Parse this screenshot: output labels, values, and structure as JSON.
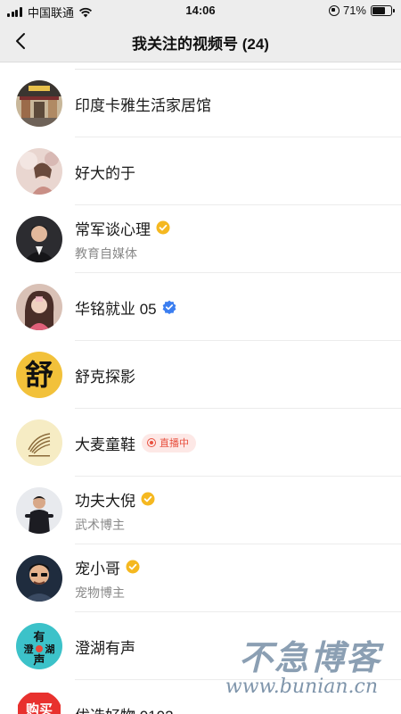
{
  "status_bar": {
    "carrier": "中国联通",
    "time": "14:06",
    "battery": "71%",
    "battery_level": 0.71
  },
  "nav": {
    "title": "我关注的视频号 (24)",
    "back_icon": "chevron-left-icon"
  },
  "items": [
    {
      "name": "印度卡雅生活家居馆",
      "sub": ""
    },
    {
      "name": "好大的于",
      "sub": ""
    },
    {
      "name": "常军谈心理",
      "sub": "教育自媒体",
      "badge": "yellow"
    },
    {
      "name": "华铭就业 05",
      "sub": "",
      "badge": "blue"
    },
    {
      "name": "舒克探影",
      "sub": "",
      "avatar_text": "舒"
    },
    {
      "name": "大麦童鞋",
      "sub": "",
      "live": "直播中"
    },
    {
      "name": "功夫大倪",
      "sub": "武术博主",
      "badge": "yellow"
    },
    {
      "name": "宠小哥",
      "sub": "宠物博主",
      "badge": "yellow"
    },
    {
      "name": "澄湖有声",
      "sub": "",
      "avatar_text": [
        "有",
        "澄",
        "湖",
        "声"
      ]
    },
    {
      "name": "优选好物 0102",
      "sub": "",
      "avatar_text": "购买"
    }
  ],
  "watermark": {
    "title": "不急博客",
    "url": "www.bunian.cn"
  },
  "colors": {
    "nav_bg": "#ededed",
    "verified_yellow": "#f5b820",
    "verified_blue": "#3b7ef0",
    "live_red": "#e8503f"
  }
}
